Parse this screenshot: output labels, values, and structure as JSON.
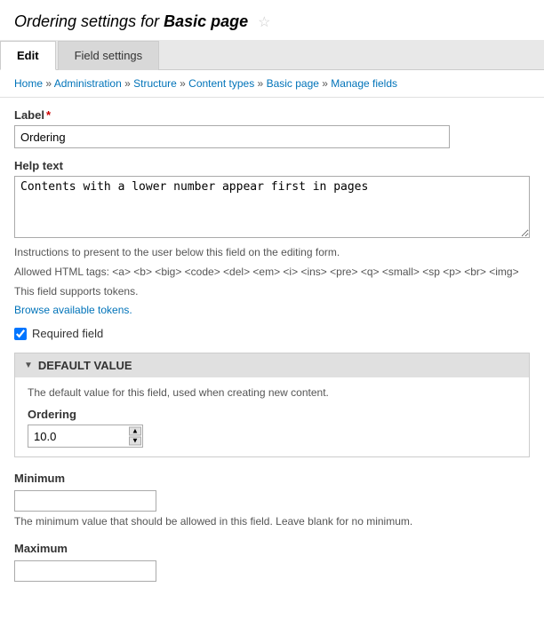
{
  "page": {
    "title_prefix": "Ordering settings for ",
    "title_italic": "Basic page",
    "star": "☆"
  },
  "tabs": [
    {
      "id": "edit",
      "label": "Edit",
      "active": true
    },
    {
      "id": "field-settings",
      "label": "Field settings",
      "active": false
    }
  ],
  "breadcrumb": {
    "items": [
      {
        "label": "Home",
        "href": "#"
      },
      {
        "label": "Administration",
        "href": "#"
      },
      {
        "label": "Structure",
        "href": "#"
      },
      {
        "label": "Content types",
        "href": "#"
      },
      {
        "label": "Basic page",
        "href": "#"
      },
      {
        "label": "Manage fields",
        "href": "#"
      }
    ],
    "separator": "»"
  },
  "form": {
    "label_field": {
      "label": "Label",
      "required": true,
      "value": "Ordering"
    },
    "help_text": {
      "label": "Help text",
      "value": "Contents with a lower number appear first in pages"
    },
    "help_description_line1": "Instructions to present to the user below this field on the editing form.",
    "help_description_line2": "Allowed HTML tags: <a> <b> <big> <code> <del> <em> <i> <ins> <pre> <q> <small> <sp <p> <br> <img>",
    "help_description_line3": "This field supports tokens.",
    "tokens_link": "Browse available tokens.",
    "required_field": {
      "label": "Required field",
      "checked": true
    },
    "default_value": {
      "header": "DEFAULT VALUE",
      "description": "The default value for this field, used when creating new content.",
      "ordering_label": "Ordering",
      "ordering_value": "10.0"
    },
    "minimum": {
      "label": "Minimum",
      "value": "",
      "description": "The minimum value that should be allowed in this field. Leave blank for no minimum."
    },
    "maximum": {
      "label": "Maximum",
      "value": ""
    }
  }
}
